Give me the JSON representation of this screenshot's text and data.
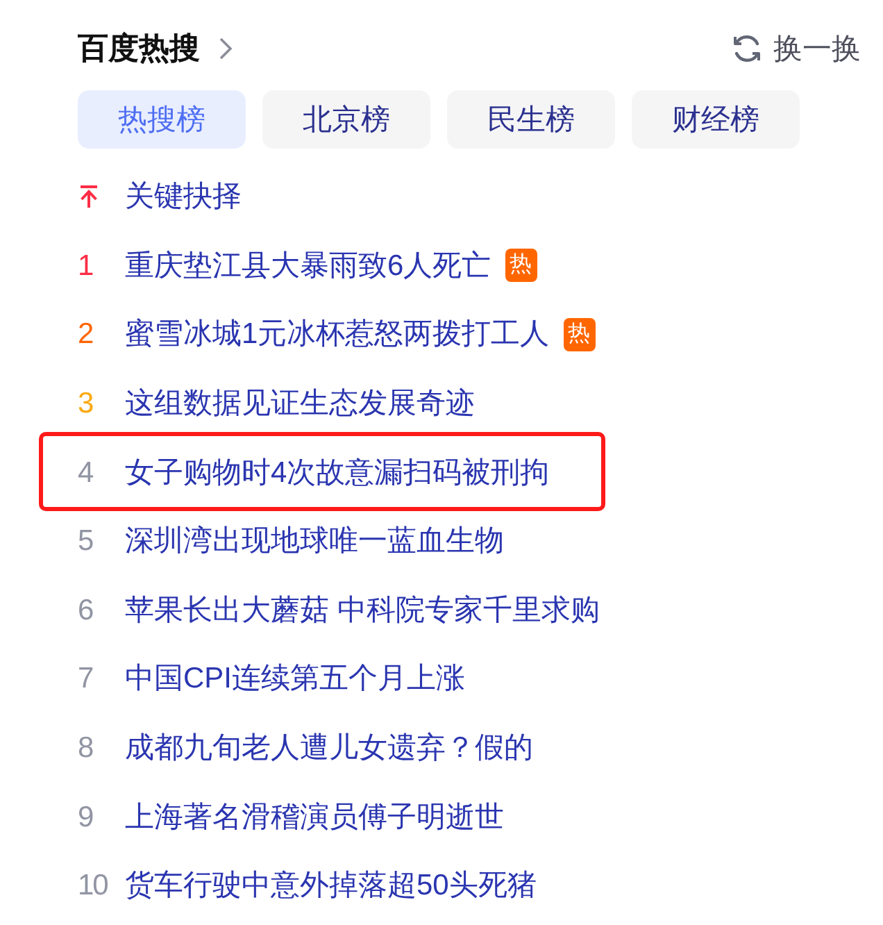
{
  "header": {
    "title": "百度热搜",
    "refresh_label": "换一换"
  },
  "tabs": [
    {
      "label": "热搜榜",
      "selected": true
    },
    {
      "label": "北京榜",
      "selected": false
    },
    {
      "label": "民生榜",
      "selected": false
    },
    {
      "label": "财经榜",
      "selected": false
    }
  ],
  "items": [
    {
      "kind": "pinned",
      "title": "关键抉择",
      "highlighted": false
    },
    {
      "kind": "ranked",
      "rank": "1",
      "color": "#fe2d46",
      "title": "重庆垫江县大暴雨致6人死亡",
      "badge": "热",
      "highlighted": false
    },
    {
      "kind": "ranked",
      "rank": "2",
      "color": "#ff6600",
      "title": "蜜雪冰城1元冰杯惹怒两拨打工人",
      "badge": "热",
      "highlighted": false
    },
    {
      "kind": "ranked",
      "rank": "3",
      "color": "#faa90e",
      "title": "这组数据见证生态发展奇迹",
      "highlighted": false
    },
    {
      "kind": "ranked",
      "rank": "4",
      "color": "#9195a3",
      "title": "女子购物时4次故意漏扫码被刑拘",
      "highlighted": true
    },
    {
      "kind": "ranked",
      "rank": "5",
      "color": "#9195a3",
      "title": "深圳湾出现地球唯一蓝血生物",
      "highlighted": false
    },
    {
      "kind": "ranked",
      "rank": "6",
      "color": "#9195a3",
      "title": "苹果长出大蘑菇 中科院专家千里求购",
      "highlighted": false
    },
    {
      "kind": "ranked",
      "rank": "7",
      "color": "#9195a3",
      "title": "中国CPI连续第五个月上涨",
      "highlighted": false
    },
    {
      "kind": "ranked",
      "rank": "8",
      "color": "#9195a3",
      "title": "成都九旬老人遭儿女遗弃？假的",
      "highlighted": false
    },
    {
      "kind": "ranked",
      "rank": "9",
      "color": "#9195a3",
      "title": "上海著名滑稽演员傅子明逝世",
      "highlighted": false
    },
    {
      "kind": "ranked",
      "rank": "10",
      "color": "#9195a3",
      "title": "货车行驶中意外掉落超50头死猪",
      "highlighted": false
    }
  ]
}
